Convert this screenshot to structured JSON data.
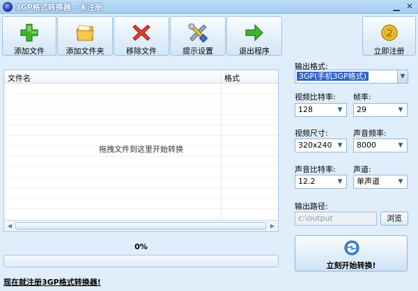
{
  "titlebar": {
    "title": "3GP格式转换器 - 未注册",
    "min_glyph": "▁",
    "close_glyph": "✕",
    "icon": "app-icon"
  },
  "toolbar": {
    "add_file": {
      "label": "添加文件",
      "icon": "plus-icon"
    },
    "add_folder": {
      "label": "添加文件夹",
      "icon": "folder-icon"
    },
    "remove_file": {
      "label": "移除文件",
      "icon": "red-x-icon"
    },
    "settings": {
      "label": "提示设置",
      "icon": "tools-icon"
    },
    "exit": {
      "label": "退出程序",
      "icon": "exit-arrow-icon"
    },
    "register": {
      "label": "立即注册",
      "icon": "coin-icon"
    }
  },
  "file_list": {
    "col_name": "文件名",
    "col_format": "格式",
    "drop_hint": "拖拽文件到这里开始转换"
  },
  "progress": {
    "percent_text": "0%",
    "value": 0
  },
  "footer": {
    "register_link": "现在就注册3GP格式转换器!"
  },
  "settings": {
    "output_format_label": "输出格式:",
    "output_format_value": "3GP(手机3GP格式)",
    "video_bitrate_label": "视频比特率:",
    "video_bitrate_value": "128",
    "frame_rate_label": "帧率:",
    "frame_rate_value": "29",
    "video_size_label": "视频尺寸:",
    "video_size_value": "320x240",
    "audio_rate_label": "声音频率:",
    "audio_rate_value": "8000",
    "audio_bitrate_label": "声音比特率:",
    "audio_bitrate_value": "12.2",
    "channel_label": "声道:",
    "channel_value": "单声道",
    "output_path_label": "输出路径:",
    "output_path_value": "c:\\output",
    "browse_label": "浏览"
  },
  "convert_button": {
    "label": "立刻开始转换!",
    "icon": "convert-icon"
  },
  "colors": {
    "accent": "#3166c5",
    "background": "#dfeefa",
    "border": "#9cc0e2"
  }
}
